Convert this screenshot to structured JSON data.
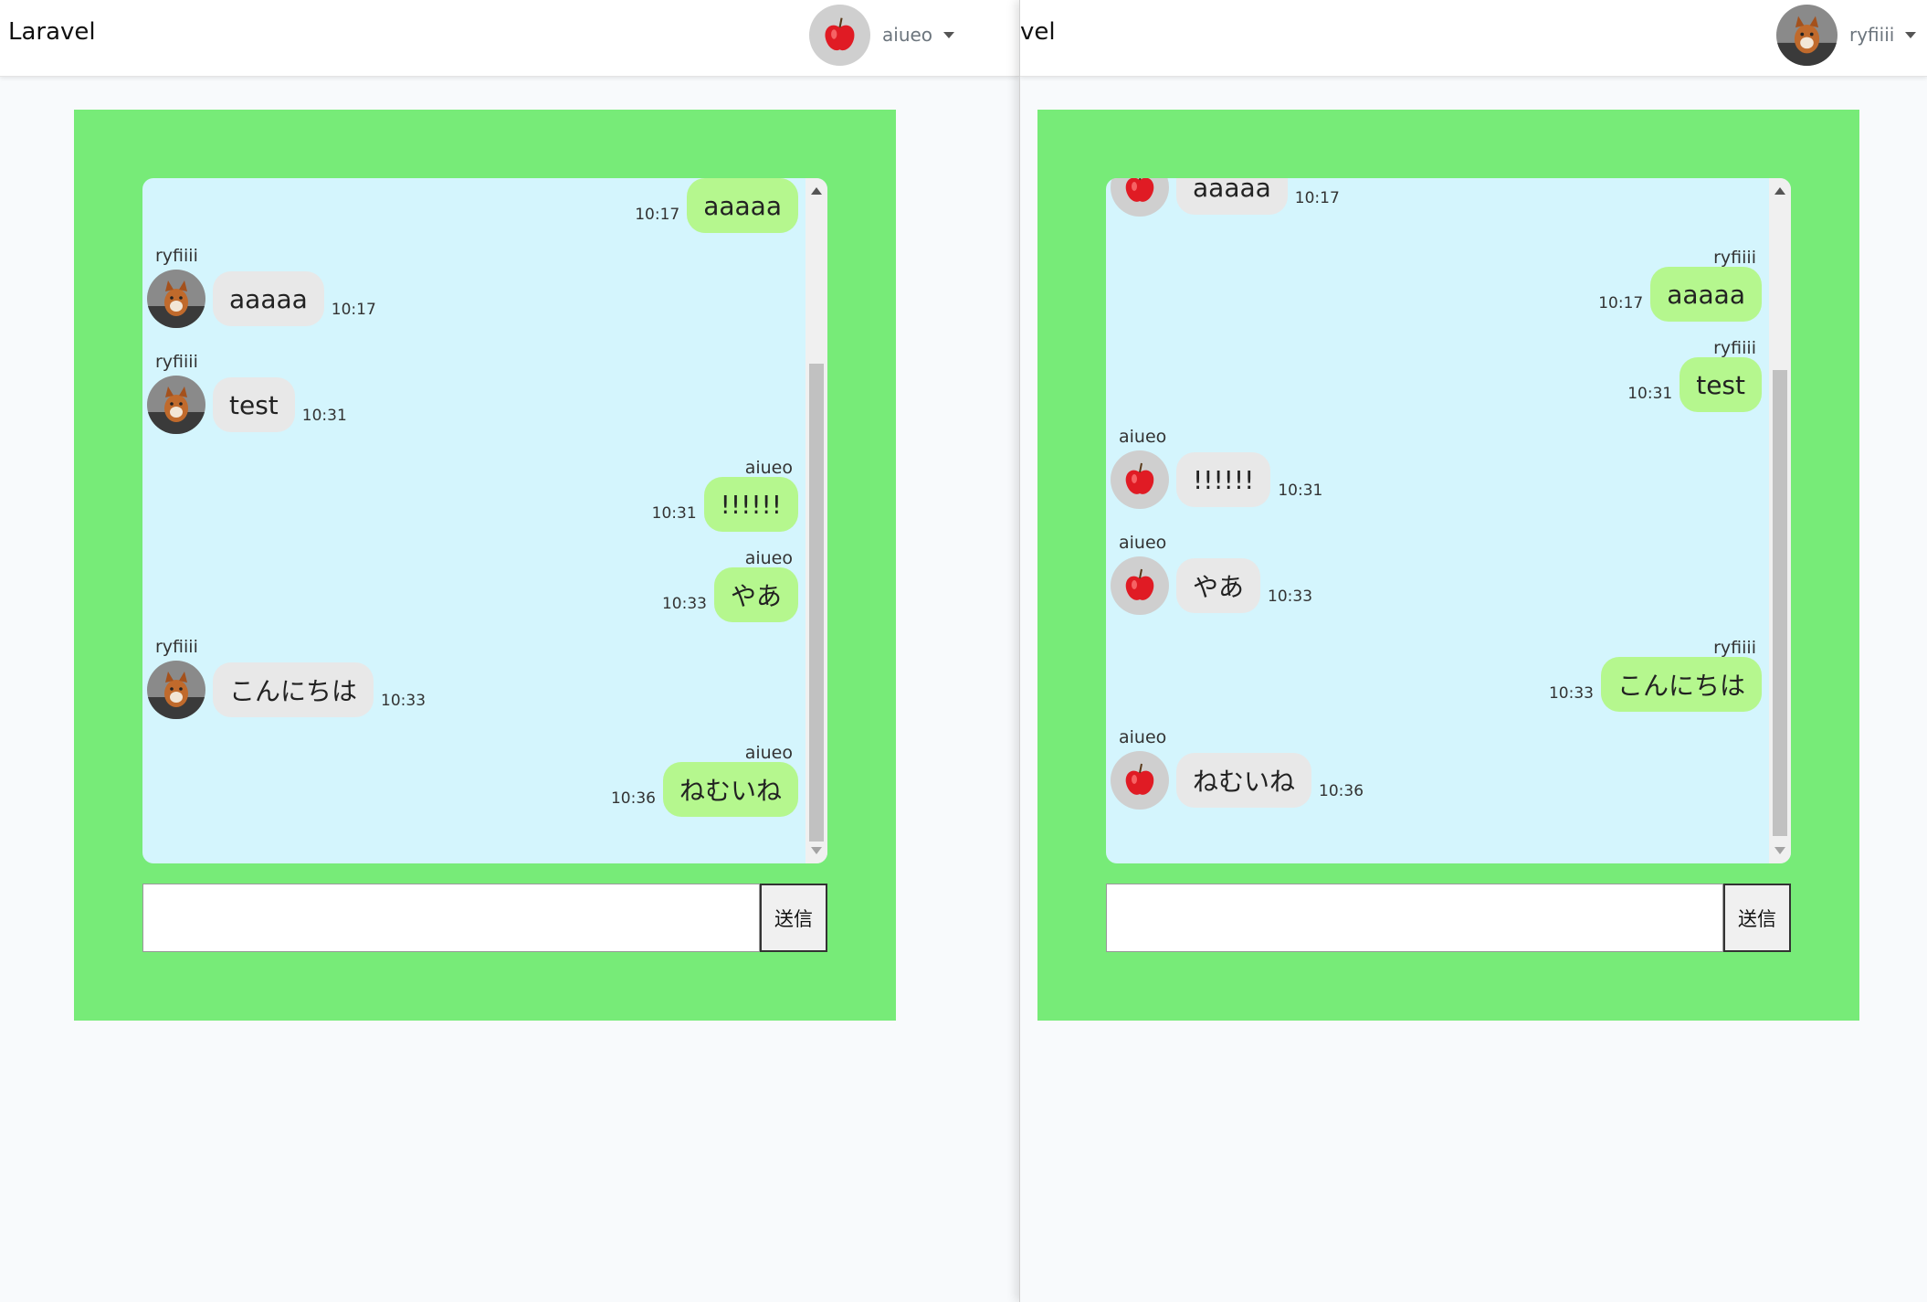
{
  "left": {
    "nav": {
      "brand": "Laravel",
      "username": "aiueo"
    },
    "form": {
      "send_label": "送信",
      "input_value": ""
    },
    "messages": [
      {
        "sender": "",
        "text": "aaaaa",
        "time": "10:17"
      },
      {
        "sender": "ryfiiii",
        "text": "aaaaa",
        "time": "10:17"
      },
      {
        "sender": "ryfiiii",
        "text": "test",
        "time": "10:31"
      },
      {
        "sender": "aiueo",
        "text": "!!!!!!",
        "time": "10:31"
      },
      {
        "sender": "aiueo",
        "text": "やあ",
        "time": "10:33"
      },
      {
        "sender": "ryfiiii",
        "text": "こんにちは",
        "time": "10:33"
      },
      {
        "sender": "aiueo",
        "text": "ねむいね",
        "time": "10:36"
      }
    ]
  },
  "right": {
    "nav": {
      "brand": "vel",
      "username": "ryfiiii"
    },
    "form": {
      "send_label": "送信",
      "input_value": ""
    },
    "messages": [
      {
        "sender": "",
        "text": "aaaaa",
        "time": "10:17"
      },
      {
        "sender": "ryfiiii",
        "text": "aaaaa",
        "time": "10:17"
      },
      {
        "sender": "ryfiiii",
        "text": "test",
        "time": "10:31"
      },
      {
        "sender": "aiueo",
        "text": "!!!!!!",
        "time": "10:31"
      },
      {
        "sender": "aiueo",
        "text": "やあ",
        "time": "10:33"
      },
      {
        "sender": "ryfiiii",
        "text": "こんにちは",
        "time": "10:33"
      },
      {
        "sender": "aiueo",
        "text": "ねむいね",
        "time": "10:36"
      }
    ]
  },
  "icons": {
    "apple_avatar": "apple-avatar-icon",
    "cat_avatar": "cat-avatar-icon",
    "dropdown_caret": "caret-down-icon"
  },
  "colors": {
    "navbar_bg": "#ffffff",
    "page_bg": "#f8fafc",
    "outer_box": "#77eb78",
    "chat_bg": "#d4f5fd",
    "outgoing_bubble": "#b5f78e",
    "incoming_bubble": "#e8e8e8"
  }
}
